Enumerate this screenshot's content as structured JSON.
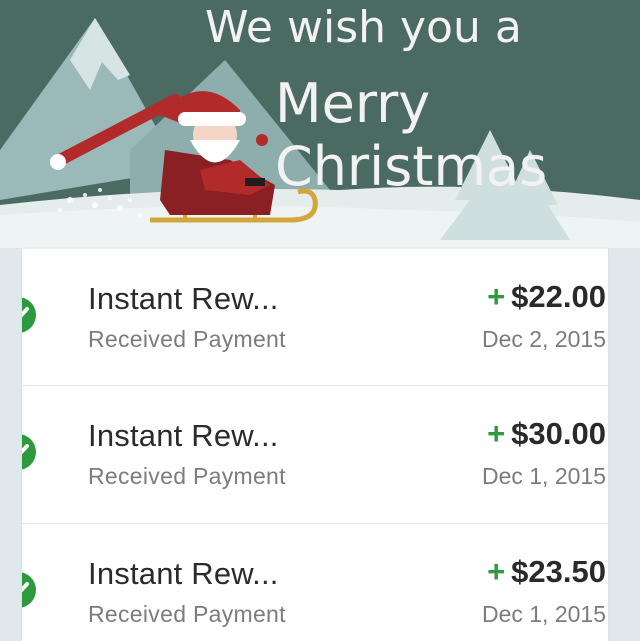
{
  "banner": {
    "line1": "We wish you a",
    "line2": "Merry Christmas"
  },
  "transactions": [
    {
      "title": "Instant Rew...",
      "subtitle": "Received Payment",
      "sign": "+",
      "amount": "$22.00",
      "date": "Dec 2, 2015"
    },
    {
      "title": "Instant Rew...",
      "subtitle": "Received Payment",
      "sign": "+",
      "amount": "$30.00",
      "date": "Dec 1, 2015"
    },
    {
      "title": "Instant Rew...",
      "subtitle": "Received Payment",
      "sign": "+",
      "amount": "$23.50",
      "date": "Dec 1, 2015"
    }
  ],
  "colors": {
    "banner_sky": "#4a6a62",
    "mountain": "#9bb9b8",
    "snow": "#e4ecec",
    "santa_red": "#b32a2a",
    "check_green": "#2e9a3e",
    "plus_green": "#2e9a3e"
  },
  "icons": [
    "check-circle-icon",
    "santa-sleigh-illustration"
  ]
}
